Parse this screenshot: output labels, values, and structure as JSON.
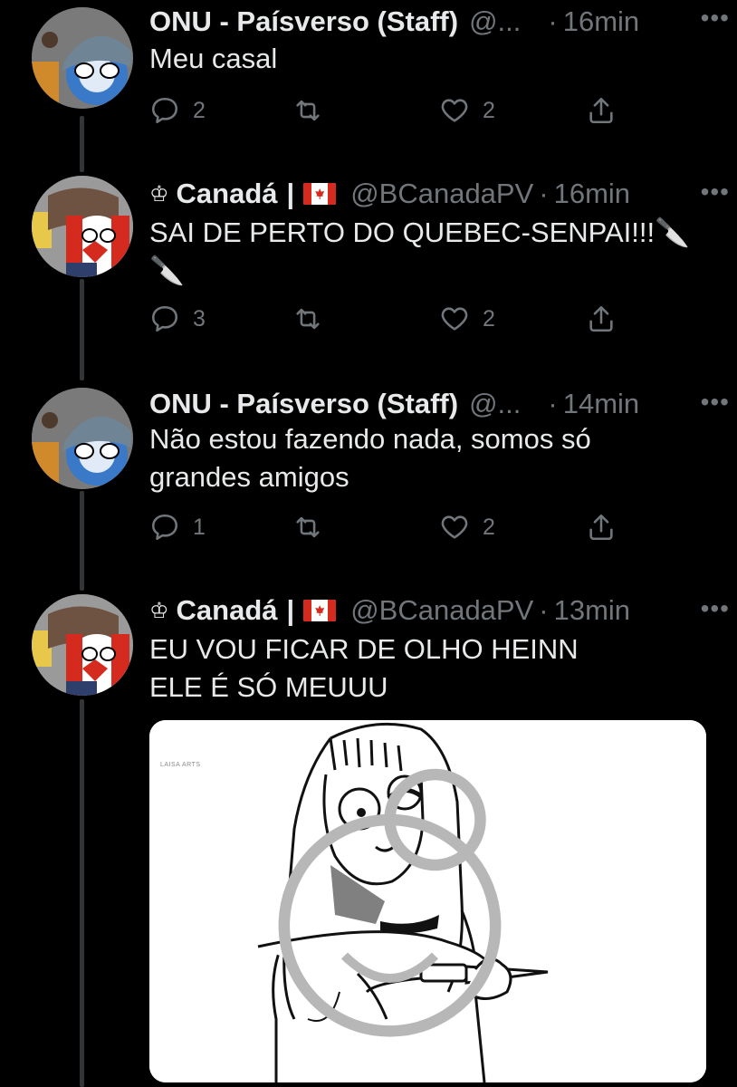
{
  "tweets": [
    {
      "name": "ONU - Paísverso (Staff)",
      "handle": "@...",
      "time": "16min",
      "more": "•••",
      "text": "Meu casal",
      "replies": "2",
      "retweets": "",
      "likes": "2"
    },
    {
      "crown": "♔",
      "name": "Canadá",
      "separator": "|",
      "handle": "@BCanadaPV",
      "time": "16min",
      "more": "•••",
      "text": "SAI DE PERTO DO QUEBEC-SENPAI!!!🔪\n🔪",
      "replies": "3",
      "retweets": "",
      "likes": "2"
    },
    {
      "name": "ONU - Paísverso (Staff)",
      "handle": "@...",
      "time": "14min",
      "more": "•••",
      "text": "Não estou fazendo nada, somos só\ngrandes amigos",
      "replies": "1",
      "retweets": "",
      "likes": "2"
    },
    {
      "crown": "♔",
      "name": "Canadá",
      "separator": "|",
      "handle": "@BCanadaPV",
      "time": "13min",
      "more": "•••",
      "text": "EU VOU FICAR DE OLHO HEINN\nELE É SÓ MEUUU",
      "media_watermark": "LAISA ARTS"
    }
  ],
  "dot_separator": "·",
  "icons": {
    "reply": "reply-icon",
    "retweet": "retweet-icon",
    "like": "heart-icon",
    "share": "share-icon"
  },
  "colors": {
    "background": "#000000",
    "text": "#e7e9ea",
    "muted": "#71767b",
    "thread_line": "#333639"
  }
}
